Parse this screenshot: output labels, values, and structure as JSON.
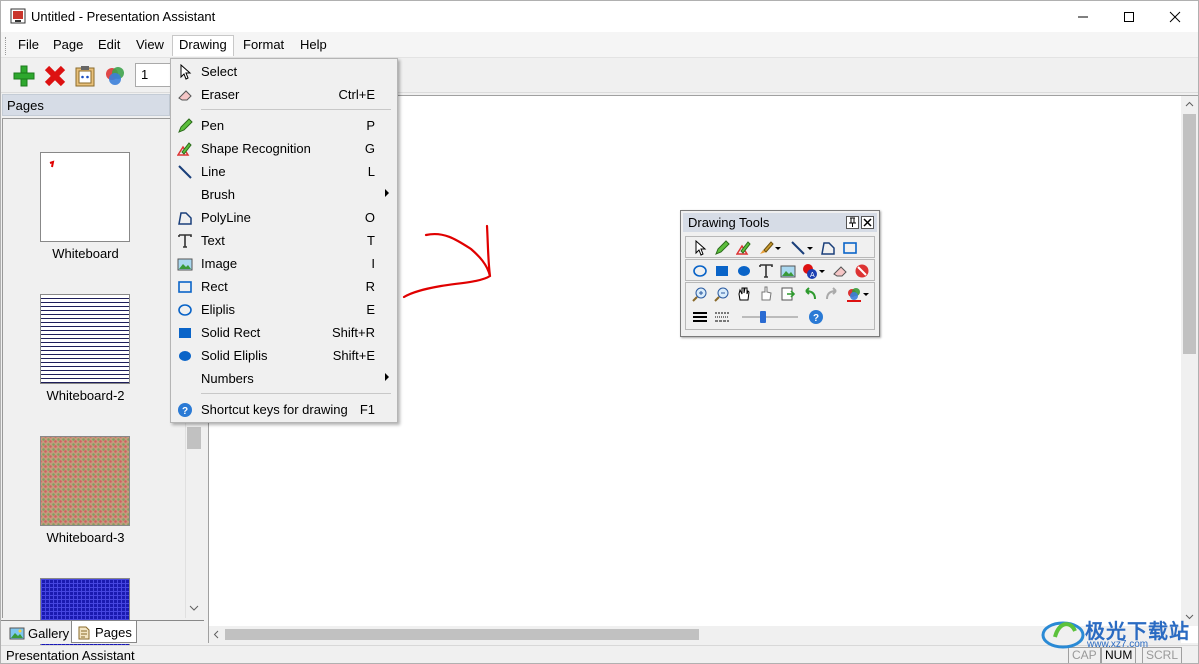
{
  "window": {
    "title": "Untitled - Presentation Assistant"
  },
  "menubar": {
    "items": [
      "File",
      "Page",
      "Edit",
      "View",
      "Drawing",
      "Format",
      "Help"
    ],
    "active": "Drawing"
  },
  "toolbar": {
    "page_value": "1",
    "icons": [
      "add-page-icon",
      "delete-page-icon",
      "clipboard-icon",
      "layers-icon"
    ]
  },
  "pages_panel": {
    "header": "Pages",
    "thumbnails": [
      {
        "label": "Whiteboard",
        "style": "white"
      },
      {
        "label": "Whiteboard-2",
        "style": "lined"
      },
      {
        "label": "Whiteboard-3",
        "style": "pattern"
      },
      {
        "label": "",
        "style": "blue-grid"
      }
    ],
    "tabs": [
      "Gallery",
      "Pages"
    ],
    "active_tab": "Pages"
  },
  "drawing_menu": {
    "items": [
      {
        "label": "Select",
        "key": "",
        "icon": "arrow-cursor-icon"
      },
      {
        "label": "Eraser",
        "key": "Ctrl+E",
        "icon": "eraser-icon"
      },
      {
        "sep": true
      },
      {
        "label": "Pen",
        "key": "P",
        "icon": "pen-icon"
      },
      {
        "label": "Shape Recognition",
        "key": "G",
        "icon": "shape-recognition-icon"
      },
      {
        "label": "Line",
        "key": "L",
        "icon": "line-icon"
      },
      {
        "label": "Brush",
        "key": "",
        "icon": "",
        "submenu": true
      },
      {
        "label": "PolyLine",
        "key": "O",
        "icon": "polyline-icon"
      },
      {
        "label": "Text",
        "key": "T",
        "icon": "text-icon"
      },
      {
        "label": "Image",
        "key": "I",
        "icon": "image-icon"
      },
      {
        "label": "Rect",
        "key": "R",
        "icon": "rect-icon"
      },
      {
        "label": "Eliplis",
        "key": "E",
        "icon": "ellipse-icon"
      },
      {
        "label": "Solid Rect",
        "key": "Shift+R",
        "icon": "solid-rect-icon"
      },
      {
        "label": "Solid Eliplis",
        "key": "Shift+E",
        "icon": "solid-ellipse-icon"
      },
      {
        "label": "Numbers",
        "key": "",
        "icon": "",
        "submenu": true
      },
      {
        "sep": true
      },
      {
        "label": "Shortcut keys for drawing",
        "key": "F1",
        "icon": "help-icon"
      }
    ]
  },
  "drawing_tools": {
    "title": "Drawing Tools"
  },
  "statusbar": {
    "text": "Presentation Assistant",
    "indicators": [
      "CAP",
      "NUM",
      "SCRL"
    ],
    "active_indicator": "NUM"
  },
  "watermark": {
    "text": "极光下载站",
    "sub": "www.xz7.com"
  },
  "colors": {
    "accent": "#0a64c8",
    "pen_stroke": "#e00000",
    "header_bg": "#d6dce6"
  }
}
